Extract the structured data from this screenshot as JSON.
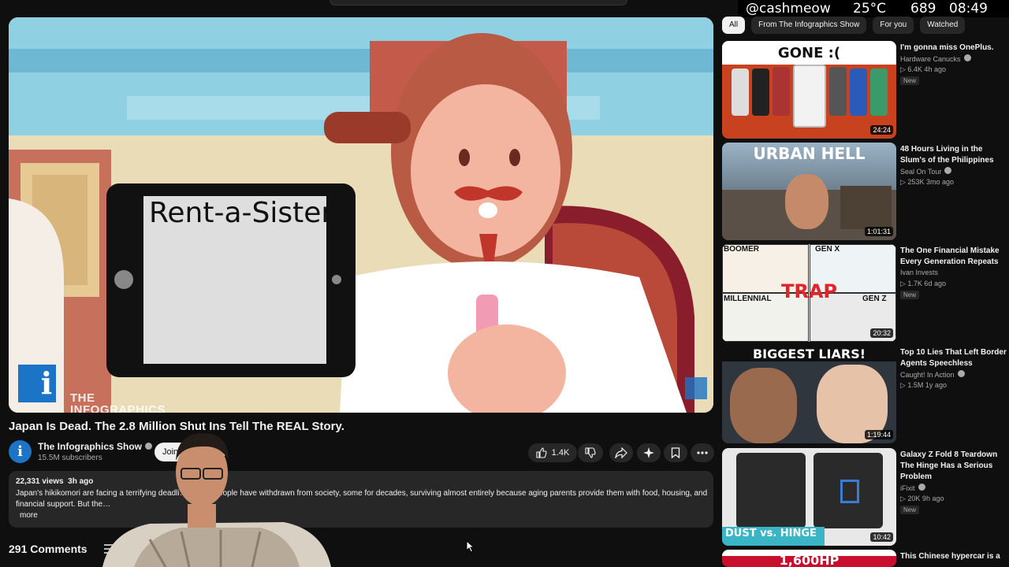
{
  "overlay": {
    "handle": "@cashmeow",
    "temperature": "25°C",
    "counter": "689",
    "time": "08:49"
  },
  "video": {
    "title": "Japan Is Dead. The 2.8 Million Shut Ins Tell The REAL Story.",
    "frame_sign_text": "Rent-a-Sister",
    "watermark": "THE\nINFOGRAPHICS\nSHOW",
    "watermark_letter": "i"
  },
  "channel": {
    "avatar_letter": "i",
    "name": "The Infographics Show",
    "subscribers": "15.5M subscribers",
    "join_label": "Join"
  },
  "actions": {
    "like_count": "1.4K"
  },
  "description": {
    "meta": "22,331 views  3h ago",
    "text": "Japan's hikikomori are facing a terrifying deadli… million people have withdrawn from society, some for decades, surviving almost entirely because aging parents provide them with food, housing, and financial support. But the…",
    "more_label": "more"
  },
  "comments": {
    "count_label": "291 Comments"
  },
  "sidebar": {
    "chips": [
      "All",
      "From The Infographics Show",
      "For you",
      "Watched"
    ],
    "active_chip": "All",
    "recommendations": [
      {
        "title": "I'm gonna miss OnePlus.",
        "channel": "Hardware Canucks",
        "stats": "▷ 6.4K  4h ago",
        "badge": "New",
        "duration": "24:24",
        "thumb_text": "GONE :("
      },
      {
        "title": "48 Hours Living in the Slum's of the Philippines",
        "channel": "Seal On Tour",
        "stats": "▷ 253K  3mo ago",
        "badge": "",
        "duration": "1:01:31",
        "thumb_text": "URBAN HELL"
      },
      {
        "title": "The One Financial Mistake Every Generation Repeats",
        "channel": "Ivan Invests",
        "stats": "▷ 1.7K  6d ago",
        "badge": "New",
        "duration": "20:32",
        "thumb_text": "TRAP",
        "thumb_labels": [
          "BOOMER",
          "GEN X",
          "MILLENNIAL",
          "GEN Z"
        ]
      },
      {
        "title": "Top 10 Lies That Left Border Agents Speechless",
        "channel": "Caught! In Action",
        "stats": "▷ 1.5M  1y ago",
        "badge": "",
        "duration": "1:19:44",
        "thumb_text": "BIGGEST LIARS!"
      },
      {
        "title": "Galaxy Z Fold 8 Teardown The Hinge Has a Serious Problem",
        "channel": "iFixit",
        "stats": "▷ 20K  9h ago",
        "badge": "New",
        "duration": "10:42",
        "thumb_text": "DUST vs. HINGE"
      },
      {
        "title": "This Chinese hypercar is a",
        "channel": "",
        "stats": "",
        "badge": "",
        "duration": "",
        "thumb_text": "1,600HP"
      }
    ]
  }
}
